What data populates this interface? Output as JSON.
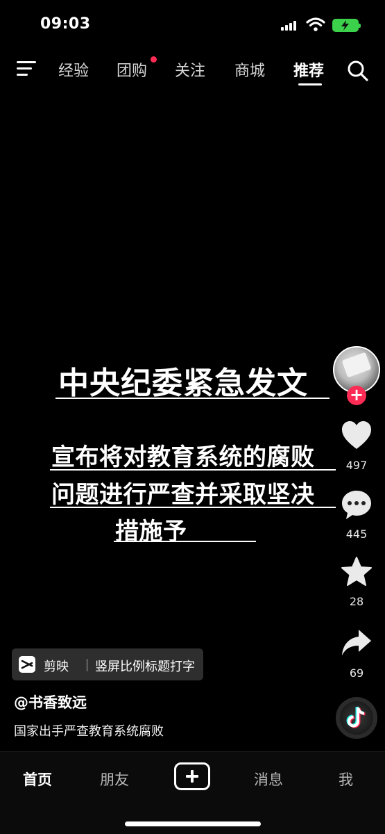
{
  "status_bar": {
    "time": "09:03"
  },
  "top_nav": {
    "tabs": [
      {
        "label": "经验"
      },
      {
        "label": "团购",
        "has_red_dot": true
      },
      {
        "label": "关注"
      },
      {
        "label": "商城"
      },
      {
        "label": "推荐",
        "active": true
      }
    ],
    "menu_icon": "menu-icon",
    "search_icon": "search-icon"
  },
  "video_overlay": {
    "headline": "中央纪委紧急发文",
    "body_lines": [
      "宣布将对教育系统的腐败",
      "问题进行严查并采取坚决",
      "措施予"
    ]
  },
  "right_rail": {
    "like_count": "497",
    "comment_count": "445",
    "favorite_count": "28",
    "share_count": "69",
    "follow_symbol": "+"
  },
  "video_info": {
    "capcut_name": "剪映",
    "capcut_desc": "竖屏比例标题打字",
    "username": "@书香致远",
    "caption": "国家出手严查教育系统腐败"
  },
  "bottom_nav": {
    "tabs": [
      {
        "label": "首页",
        "active": true
      },
      {
        "label": "朋友"
      },
      {
        "label": "消息"
      },
      {
        "label": "我"
      }
    ]
  },
  "colors": {
    "accent_red": "#fe2c55",
    "battery_green": "#3bd14b"
  }
}
